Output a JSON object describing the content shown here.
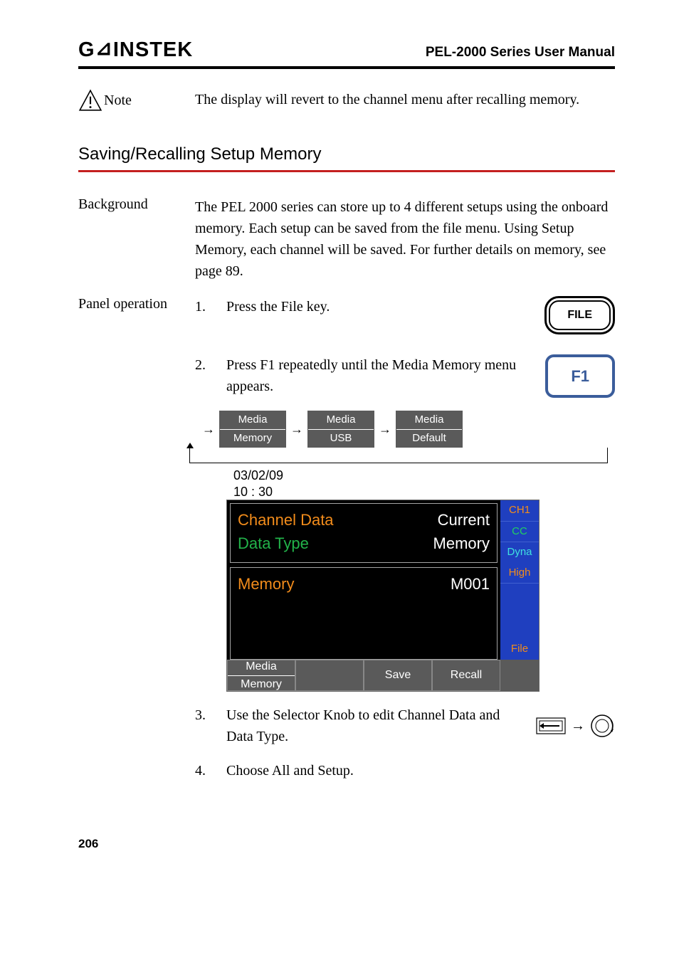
{
  "header": {
    "brand": "GWINSTEK",
    "manual_title": "PEL-2000 Series User Manual"
  },
  "note": {
    "label": "Note",
    "text": "The display will revert to the channel menu after recalling memory."
  },
  "section_title": "Saving/Recalling Setup Memory",
  "background": {
    "label": "Background",
    "text": "The PEL 2000 series can store up to 4 different setups using the onboard memory. Each setup can be saved from the file menu. Using Setup Memory, each channel will be saved. For further details on memory, see page 89."
  },
  "panel_operation": {
    "label": "Panel operation",
    "steps": [
      {
        "num": "1.",
        "text": "Press the File key."
      },
      {
        "num": "2.",
        "text": "Press F1 repeatedly until the Media Memory menu appears."
      },
      {
        "num": "3.",
        "text": "Use the Selector Knob to edit Channel Data and Data Type."
      },
      {
        "num": "4.",
        "text": "Choose All and Setup."
      }
    ]
  },
  "buttons": {
    "file": "FILE",
    "f1": "F1"
  },
  "media_cycle": [
    {
      "top": "Media",
      "bottom": "Memory"
    },
    {
      "top": "Media",
      "bottom": "USB"
    },
    {
      "top": "Media",
      "bottom": "Default"
    }
  ],
  "screen": {
    "date": "03/02/09",
    "time": "10 : 30",
    "rows": [
      {
        "left": "Channel Data",
        "right": "Current"
      },
      {
        "left": "Data Type",
        "right": "Memory"
      },
      {
        "left": "Memory",
        "right": "M001"
      }
    ],
    "softkeys": [
      {
        "top": "Media",
        "bottom": "Memory"
      },
      {
        "label": ""
      },
      {
        "label": "Save"
      },
      {
        "label": "Recall"
      }
    ],
    "side": {
      "ch": "CH1",
      "mode": "CC",
      "dyna": "Dyna",
      "level": "High",
      "file": "File"
    }
  },
  "page_number": "206"
}
